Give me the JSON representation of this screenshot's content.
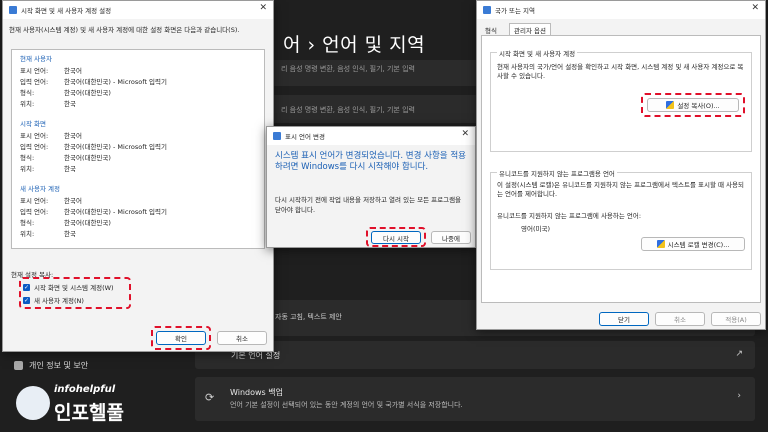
{
  "settings_bg": {
    "title": "어 › 언어 및 지역",
    "sub_line1": "리 음성 명령 변환, 음성 인식, 필기, 기본 입력",
    "sub_line2": "리 음성 명령 변환, 음성 인식, 필기, 기본 입력",
    "row_partial": "자동 고침, 텍스트 제안",
    "admin_lang_setting": "기본 언어 설정",
    "backup_title": "Windows 백업",
    "backup_desc": "언어 기본 설정이 선택되어 있는 동안 계정의 언어 및 국가별 서식을 저장합니다.",
    "sidebar_privacy": "개인 정보 및 보안",
    "watermark_top": "infohelpful",
    "watermark_bottom": "인포헬풀"
  },
  "copy_dialog": {
    "title": "시작 화면 및 새 사용자 계정 설정",
    "intro": "현재 사용자(시스템 계정) 및 새 사용자 계정에 대한 설정 화면은 다음과 같습니다(S).",
    "sections": [
      {
        "name": "현재 사용자",
        "rows": [
          [
            "표시 언어:",
            "한국어"
          ],
          [
            "입력 언어:",
            "한국어(대한민국) - Microsoft 입력기"
          ],
          [
            "형식:",
            "한국어(대한민국)"
          ],
          [
            "위치:",
            "한국"
          ]
        ]
      },
      {
        "name": "시작 화면",
        "rows": [
          [
            "표시 언어:",
            "한국어"
          ],
          [
            "입력 언어:",
            "한국어(대한민국) - Microsoft 입력기"
          ],
          [
            "형식:",
            "한국어(대한민국)"
          ],
          [
            "위치:",
            "한국"
          ]
        ]
      },
      {
        "name": "새 사용자 계정",
        "rows": [
          [
            "표시 언어:",
            "한국어"
          ],
          [
            "입력 언어:",
            "한국어(대한민국) - Microsoft 입력기"
          ],
          [
            "형식:",
            "한국어(대한민국)"
          ],
          [
            "위치:",
            "한국"
          ]
        ]
      }
    ],
    "copy_label": "현재 설정 복사:",
    "check_welcome": "시작 화면 및 시스템 계정(W)",
    "check_new_user": "새 사용자 계정(N)",
    "ok": "확인",
    "cancel": "취소"
  },
  "lang_change_dialog": {
    "title": "표시 언어 변경",
    "heading": "시스템 표시 언어가 변경되었습니다. 변경 사항을 적용하려면 Windows를 다시 시작해야 합니다.",
    "body": "다시 시작하기 전에 작업 내용을 저장하고 열려 있는 모든 프로그램을 닫아야 합니다.",
    "restart": "다시 시작",
    "later": "나중에"
  },
  "region_dialog": {
    "title": "국가 또는 지역",
    "tabs": [
      "형식",
      "관리자 옵션"
    ],
    "group1_title": "시작 화면 및 새 사용자 계정",
    "group1_desc": "현재 사용자의 국가/언어 설정을 확인하고 시작 화면, 시스템 계정 및 새 사용자 계정으로 복사할 수 있습니다.",
    "copy_settings": "설정 복사(O)...",
    "group2_title": "유니코드를 지원하지 않는 프로그램용 언어",
    "group2_desc": "이 설정(시스템 로캘)은 유니코드를 지원하지 않는 프로그램에서 텍스트를 표시할 때 사용되는 언어를 제어합니다.",
    "current_label": "유니코드를 지원하지 않는 프로그램에 사용하는 언어:",
    "current_value": "영어(미국)",
    "change_locale": "시스템 로캘 변경(C)...",
    "ok": "닫기",
    "cancel": "취소",
    "apply": "적용(A)"
  }
}
